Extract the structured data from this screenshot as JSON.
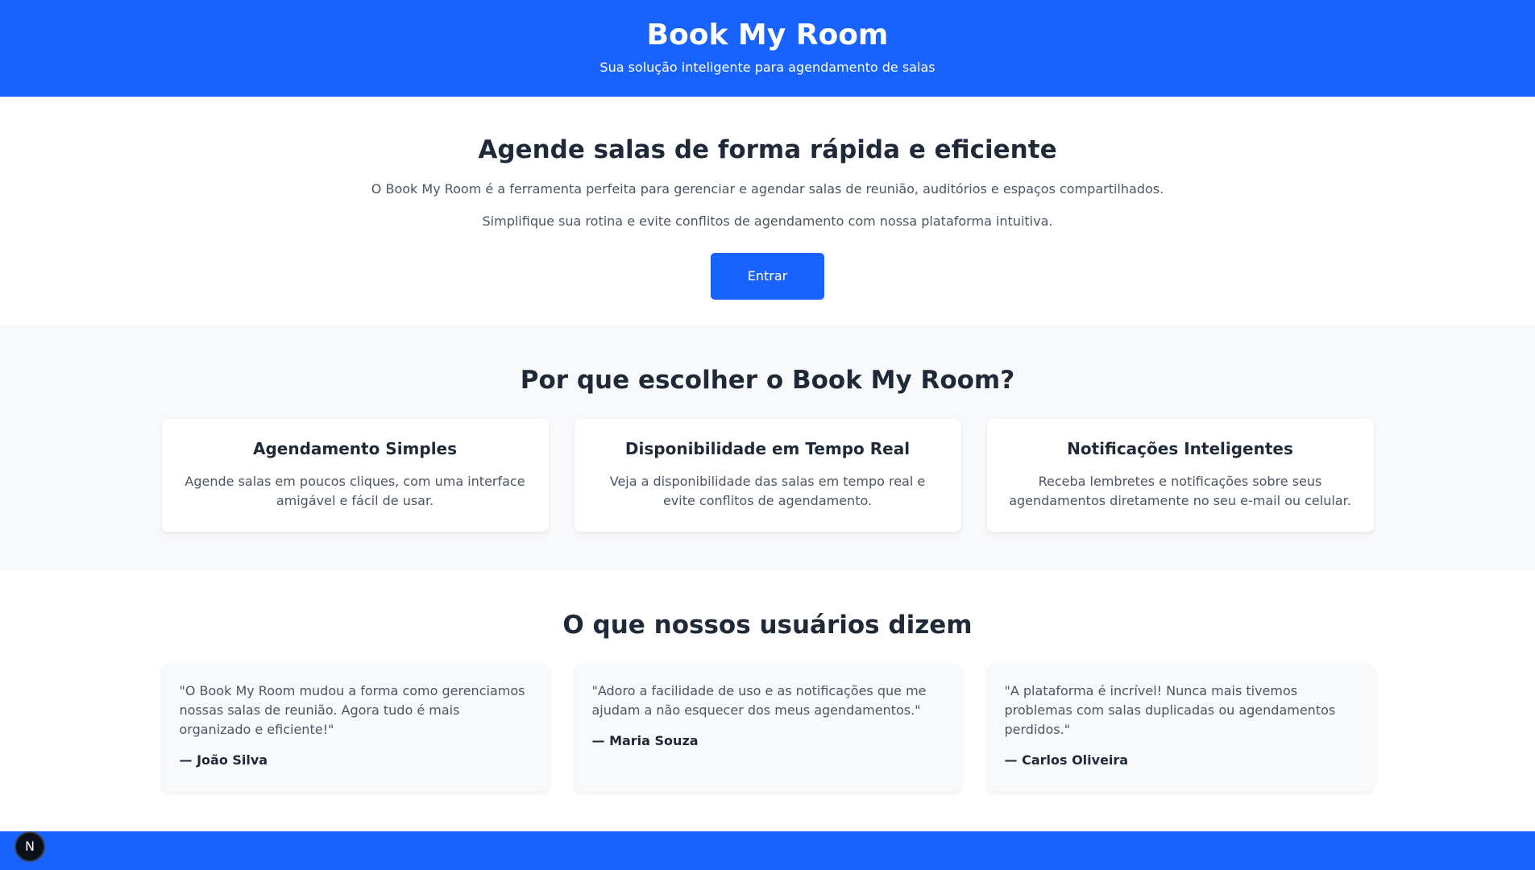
{
  "header": {
    "title": "Book My Room",
    "subtitle": "Sua solução inteligente para agendamento de salas"
  },
  "hero": {
    "title": "Agende salas de forma rápida e eficiente",
    "paragraph1": "O Book My Room é a ferramenta perfeita para gerenciar e agendar salas de reunião, auditórios e espaços compartilhados.",
    "paragraph2": "Simplifique sua rotina e evite conflitos de agendamento com nossa plataforma intuitiva.",
    "button_label": "Entrar"
  },
  "features": {
    "title": "Por que escolher o Book My Room?",
    "items": [
      {
        "title": "Agendamento Simples",
        "description": "Agende salas em poucos cliques, com uma interface amigável e fácil de usar."
      },
      {
        "title": "Disponibilidade em Tempo Real",
        "description": "Veja a disponibilidade das salas em tempo real e evite conflitos de agendamento."
      },
      {
        "title": "Notificações Inteligentes",
        "description": "Receba lembretes e notificações sobre seus agendamentos diretamente no seu e-mail ou celular."
      }
    ]
  },
  "testimonials": {
    "title": "O que nossos usuários dizem",
    "items": [
      {
        "quote": "\"O Book My Room mudou a forma como gerenciamos nossas salas de reunião. Agora tudo é mais organizado e eficiente!\"",
        "author": "— João Silva"
      },
      {
        "quote": "\"Adoro a facilidade de uso e as notificações que me ajudam a não esquecer dos meus agendamentos.\"",
        "author": "— Maria Souza"
      },
      {
        "quote": "\"A plataforma é incrível! Nunca mais tivemos problemas com salas duplicadas ou agendamentos perdidos.\"",
        "author": "— Carlos Oliveira"
      }
    ]
  },
  "badge": {
    "letter": "N",
    "icon": "nextjs-icon"
  },
  "colors": {
    "primary": "#1863fd",
    "section_bg": "#f8f9fb",
    "heading": "#1f2937",
    "body_text": "#4b5563"
  }
}
